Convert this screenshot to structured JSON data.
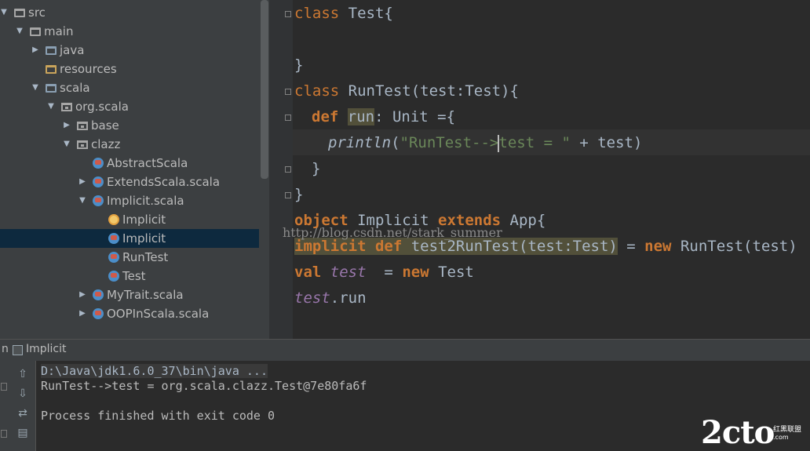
{
  "project_tree": {
    "items": [
      {
        "label": "src",
        "icon": "folder-icon",
        "depth": 0,
        "arrow": "▼"
      },
      {
        "label": "main",
        "icon": "folder-icon",
        "depth": 1,
        "arrow": "▼"
      },
      {
        "label": "java",
        "icon": "source-folder-icon",
        "depth": 2,
        "arrow": "▶"
      },
      {
        "label": "resources",
        "icon": "resources-folder-icon",
        "depth": 2,
        "arrow": ""
      },
      {
        "label": "scala",
        "icon": "source-folder-icon",
        "depth": 2,
        "arrow": "▼"
      },
      {
        "label": "org.scala",
        "icon": "package-icon",
        "depth": 3,
        "arrow": "▼"
      },
      {
        "label": "base",
        "icon": "package-icon",
        "depth": 4,
        "arrow": "▶"
      },
      {
        "label": "clazz",
        "icon": "package-icon",
        "depth": 4,
        "arrow": "▼"
      },
      {
        "label": "AbstractScala",
        "icon": "scala-class-icon",
        "depth": 5,
        "arrow": ""
      },
      {
        "label": "ExtendsScala.scala",
        "icon": "scala-file-icon",
        "depth": 5,
        "arrow": "▶"
      },
      {
        "label": "Implicit.scala",
        "icon": "scala-file-icon",
        "depth": 5,
        "arrow": "▼"
      },
      {
        "label": "Implicit",
        "icon": "scala-object-icon",
        "depth": 6,
        "arrow": ""
      },
      {
        "label": "Implicit",
        "icon": "scala-class-icon",
        "depth": 6,
        "arrow": "",
        "selected": true
      },
      {
        "label": "RunTest",
        "icon": "scala-class-icon",
        "depth": 6,
        "arrow": ""
      },
      {
        "label": "Test",
        "icon": "scala-class-icon",
        "depth": 6,
        "arrow": ""
      },
      {
        "label": "MyTrait.scala",
        "icon": "scala-file-icon",
        "depth": 5,
        "arrow": "▶"
      },
      {
        "label": "OOPInScala.scala",
        "icon": "scala-file-icon",
        "depth": 5,
        "arrow": "▶"
      }
    ]
  },
  "editor": {
    "lines": {
      "l1a": "class",
      "l1b": " Test{",
      "l2": "}",
      "l3a": "class",
      "l3b": " RunTest(test:Test){",
      "l4a": "def",
      "l4b": "run",
      "l4c": ": Unit ={",
      "l4ws": "  ",
      "l4unit": "",
      "l5a": "println",
      "l5b": "(",
      "l5c": "\"RunTest-->",
      "l5d": "test = \"",
      "l5e": " + test)",
      "l6": "}",
      "l7": "}",
      "l8a": "object",
      "l8b": " Implicit ",
      "l8c": "extends",
      "l8d": " App{",
      "l9a": "implicit",
      "l9b": "def",
      "l9c": " test2RunTest(test:Test)",
      "l9d": " = ",
      "l9e": "new",
      "l9f": " RunTest(test)",
      "l10a": "val",
      "l10b": "test",
      "l10c": "  = ",
      "l10d": "new",
      "l10e": " Test",
      "l11a": "test",
      "l11b": ".run"
    },
    "watermark": "http://blog.csdn.net/stark_summer"
  },
  "run_panel": {
    "tab_prefix": "n",
    "tab_title": "Implicit",
    "console": [
      "D:\\Java\\jdk1.6.0_37\\bin\\java ...",
      "RunTest-->test = org.scala.clazz.Test@7e80fa6f",
      "",
      "Process finished with exit code 0"
    ]
  },
  "logo": {
    "text": "2cto",
    "sub1": "红黑联盟",
    "sub2": ".com"
  },
  "colors": {
    "keyword": "#cc7832",
    "string": "#6a8759",
    "field": "#9876aa",
    "selection": "#0d293e"
  }
}
